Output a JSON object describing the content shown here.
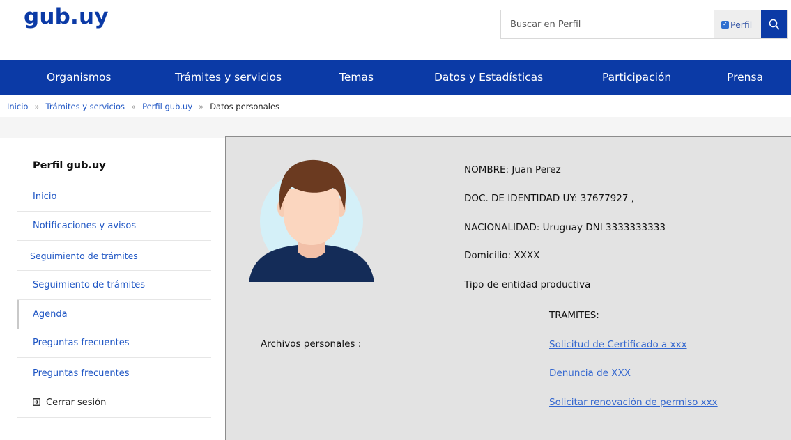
{
  "header": {
    "logo": "gub.uy",
    "search": {
      "placeholder": "Buscar en Perfil",
      "scope_label": "Perfil",
      "scope_checked": true
    }
  },
  "nav": {
    "items": [
      "Organismos",
      "Trámites y servicios",
      "Temas",
      "Datos y Estadísticas",
      "Participación",
      "Prensa"
    ]
  },
  "breadcrumb": {
    "items": [
      "Inicio",
      "Trámites y servicios",
      "Perfil gub.uy"
    ],
    "separator": "»",
    "current": "Datos personales"
  },
  "sidebar": {
    "title": "Perfil gub.uy",
    "items": [
      "Inicio",
      "Notificaciones y avisos",
      "Seguimiento de trámites",
      "Seguimiento de trámites",
      "Agenda",
      "Preguntas frecuentes",
      "Preguntas frecuentes"
    ],
    "logout_label": "Cerrar sesión"
  },
  "profile": {
    "nombre": "NOMBRE:  Juan Perez",
    "documento": "DOC. DE IDENTIDAD UY: 37677927 ,",
    "nacionalidad": "NACIONALIDAD: Uruguay DNI 3333333333",
    "domicilio": "Domicilio: XXXX",
    "tipo_entidad": "Tipo de entidad productiva",
    "archivos_label": "Archivos personales :",
    "tramites_title": "TRAMITES:",
    "tramites": [
      "Solicitud  de Certificado a xxx",
      "Denuncia de XXX",
      "Solicitar renovación de permiso xxx"
    ]
  },
  "colors": {
    "brand_blue": "#0b3aa6",
    "link_blue": "#1f56c4",
    "panel_bg": "#e3e3e3"
  }
}
